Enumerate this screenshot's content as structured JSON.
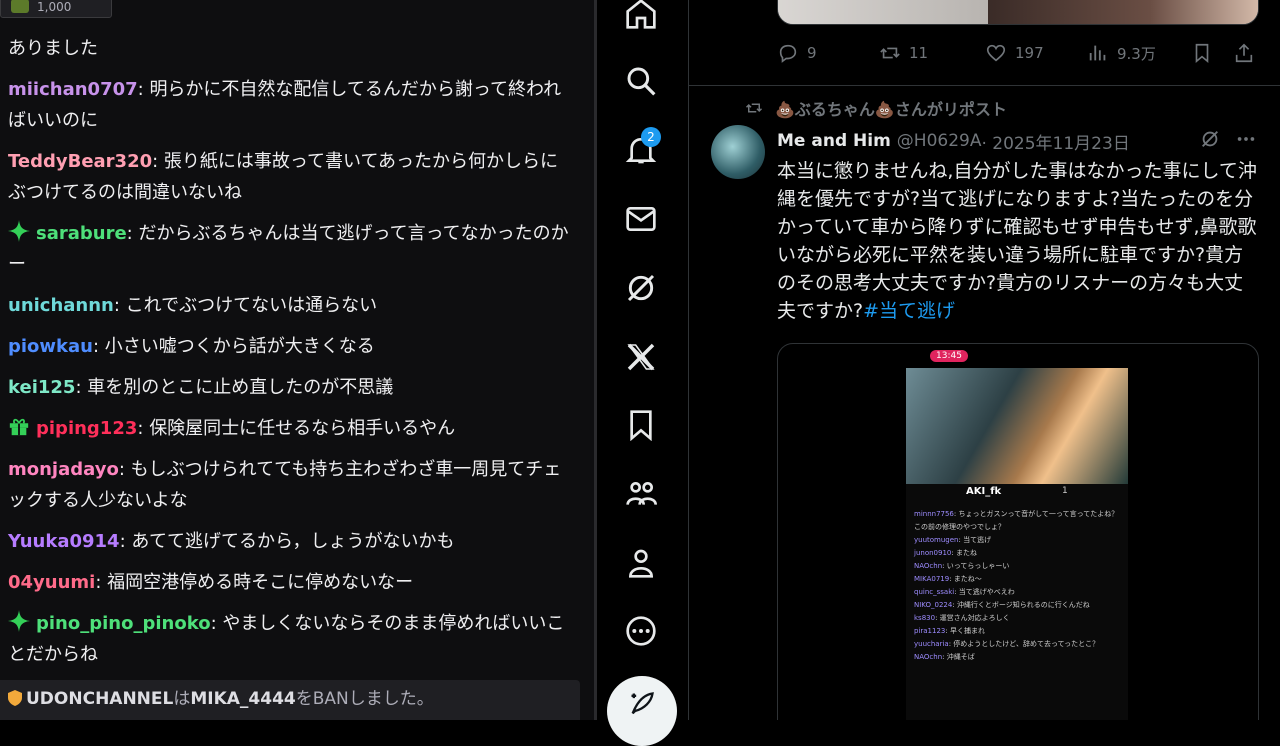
{
  "chat": {
    "top_badge_count": "1,000",
    "messages": [
      {
        "user": "",
        "color": "#efeff1",
        "badge": "",
        "text": "ありました"
      },
      {
        "user": "miichan0707",
        "color": "#c792ea",
        "badge": "",
        "text": "明らかに不自然な配信してるんだから謝って終わればいいのに"
      },
      {
        "user": "TeddyBear320",
        "color": "#ff9fb2",
        "badge": "",
        "text": "張り紙には事故って書いてあったから何かしらにぶつけてるのは間違いないね"
      },
      {
        "user": "sarabure",
        "color": "#4ee07a",
        "badge": "spark",
        "text": "だからぶるちゃんは当て逃げって言ってなかったのかー"
      },
      {
        "user": "unichannn",
        "color": "#6fd9d9",
        "badge": "",
        "text": "これでぶつけてないは通らない"
      },
      {
        "user": "piowkau",
        "color": "#4f8dff",
        "badge": "",
        "text": "小さい嘘つくから話が大きくなる"
      },
      {
        "user": "kei125",
        "color": "#7ee8c7",
        "badge": "",
        "text": "車を別のとこに止め直したのが不思議"
      },
      {
        "user": "piping123",
        "color": "#ff2f5a",
        "badge": "gift",
        "text": "保険屋同士に任せるなら相手いるやん"
      },
      {
        "user": "monjadayo",
        "color": "#ff85c0",
        "badge": "",
        "text": "もしぶつけられてても持ち主わざわざ車一周見てチェックする人少ないよな"
      },
      {
        "user": "Yuuka0914",
        "color": "#b67cff",
        "badge": "",
        "text": "あてて逃げてるから，しょうがないかも"
      },
      {
        "user": "04yuumi",
        "color": "#ff6b8a",
        "badge": "",
        "text": "福岡空港停める時そこに停めないなー"
      },
      {
        "user": "pino_pino_pinoko",
        "color": "#4ee07a",
        "badge": "spark",
        "text": "やましくないならそのまま停めればいいことだからね"
      }
    ],
    "ban": {
      "moderator": "UDONCHANNEL",
      "mid1": "は",
      "target": "MIKA_4444",
      "tail": "をBANしました。"
    }
  },
  "nav": {
    "notification_count": "2",
    "icons": [
      "home-icon",
      "explore-icon",
      "notifications-icon",
      "messages-icon",
      "grok-icon",
      "x-premium-icon",
      "bookmarks-icon",
      "communities-icon",
      "profile-icon",
      "more-icon"
    ]
  },
  "prev_tweet": {
    "replies": "9",
    "reposts": "11",
    "likes": "197",
    "views": "9.3万"
  },
  "tweet": {
    "repost_by": "💩ぶるちゃん💩さんがリポスト",
    "author": "Me and Him",
    "handle": "@H0629A",
    "date": "· 2025年11月23日",
    "text": "本当に懲りませんね,自分がした事はなかった事にして沖縄を優先ですが?当て逃げになりますよ?当たったのを分かっていて車から降りずに確認もせず申告もせず,鼻歌歌いながら必死に平然を装い違う場所に駐車ですか?貴方のその思考大丈夫ですか?貴方のリスナーの方々も大丈夫ですか?",
    "hashtag": "#当て逃げ",
    "media": {
      "clock": "13:45",
      "streamer": "AKI_fk",
      "viewers": "1",
      "chat_lines": [
        {
          "name": "minnn7756",
          "text": "ちょっとガスンって音がして一って言ってたよね？この前の修理のやつでしょ？"
        },
        {
          "name": "yuutomugen",
          "text": "当て逃げ"
        },
        {
          "name": "junon0910",
          "text": "またね"
        },
        {
          "name": "NAOchn",
          "text": "いってらっしゃーい"
        },
        {
          "name": "MIKA0719",
          "text": "またね～"
        },
        {
          "name": "quinc_ssaki",
          "text": "当て逃げやべえわ"
        },
        {
          "name": "NIKO_0224",
          "text": "沖縄行くとボージ知られるのに行くんだね"
        },
        {
          "name": "ks830",
          "text": "運営さん対応よろしく"
        },
        {
          "name": "pira1123",
          "text": "早く捕まれ"
        },
        {
          "name": "yuucharia",
          "text": "停めようとしたけど、辞めて去ってったとこ？"
        },
        {
          "name": "NAOchn",
          "text": "沖縄そば"
        }
      ]
    }
  }
}
